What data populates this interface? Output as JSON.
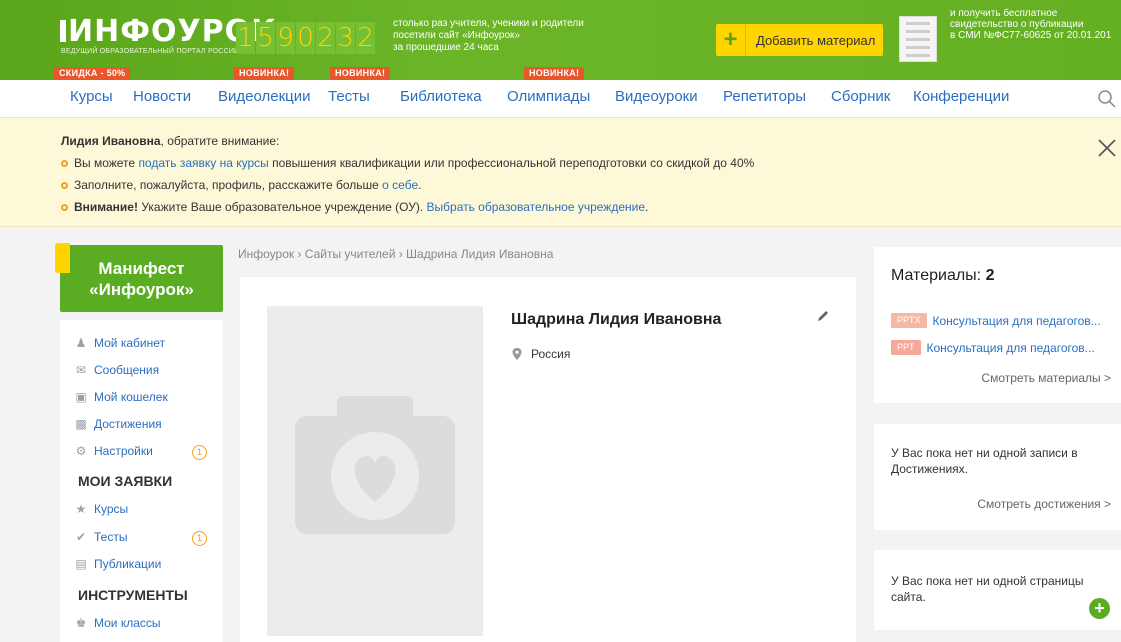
{
  "header": {
    "logo": "ИНФОУРОК",
    "logo_sub": "ВЕДУЩИЙ ОБРАЗОВАТЕЛЬНЫЙ ПОРТАЛ РОССИИ",
    "counter_digits": [
      "1",
      "5",
      "9",
      "0",
      "2",
      "3",
      "2"
    ],
    "counter_text_1": "столько раз учителя, ученики и родители",
    "counter_text_2": "посетили сайт «Инфоурок»",
    "counter_text_3": "за прошедшие 24 часа",
    "add_material": "Добавить материал",
    "cert_text_1": "и получить бесплатное",
    "cert_text_2": "свидетельство о публикации",
    "cert_text_3": "в СМИ №ФС77-60625 от 20.01.201"
  },
  "badges": {
    "discount": "СКИДКА - 50%",
    "new_1": "НОВИНКА!",
    "new_2": "НОВИНКА!",
    "new_3": "НОВИНКА!"
  },
  "nav": [
    "Курсы",
    "Новости",
    "Видеолекции",
    "Тесты",
    "Библиотека",
    "Олимпиады",
    "Видеоуроки",
    "Репетиторы",
    "Сборник",
    "Конференции"
  ],
  "notice": {
    "name": "Лидия Ивановна",
    "intro": ", обратите внимание:",
    "l1_pre": "Вы можете ",
    "l1_link": "подать заявку на курсы",
    "l1_post": " повышения квалификации или профессиональной переподготовки со скидкой до 40%",
    "l2_pre": "Заполните, пожалуйста, профиль, расскажите больше ",
    "l2_link": "о себе",
    "l2_post": ".",
    "l3_bold": "Внимание!",
    "l3_pre": " Укажите Ваше образовательное учреждение (ОУ). ",
    "l3_link": "Выбрать образовательное учреждение",
    "l3_post": "."
  },
  "sidebar": {
    "manifest_1": "Манифест",
    "manifest_2": "«Инфоурок»",
    "items": [
      "Мой кабинет",
      "Сообщения",
      "Мой кошелек",
      "Достижения",
      "Настройки"
    ],
    "settings_count": "1",
    "head_1": "МОИ ЗАЯВКИ",
    "requests": [
      "Курсы",
      "Тесты",
      "Публикации"
    ],
    "tests_count": "1",
    "head_2": "ИНСТРУМЕНТЫ",
    "tools": [
      "Мои классы"
    ]
  },
  "main": {
    "breadcrumb": "Инфоурок › Сайты учителей › Шадрина Лидия Ивановна",
    "name": "Шадрина Лидия Ивановна",
    "country": "Россия"
  },
  "right": {
    "materials_label": "Материалы: ",
    "materials_count": "2",
    "materials": [
      {
        "tag": "PPTX",
        "title": "Консультация для педагогов..."
      },
      {
        "tag": "PPT",
        "title": "Консультация для педагогов..."
      }
    ],
    "see_materials": "Смотреть материалы >",
    "achievements_text_1": "У Вас пока нет ни одной записи в",
    "achievements_text_2": "Достижениях.",
    "see_achievements": "Смотреть достижения >",
    "pages_text_1": "У Вас пока нет ни одной страницы",
    "pages_text_2": "сайта."
  },
  "colors": {
    "brand_green": "#5aad23",
    "accent_yellow": "#ffd400",
    "badge_red": "#e8562a",
    "tag_orange": "#f6a99a"
  }
}
